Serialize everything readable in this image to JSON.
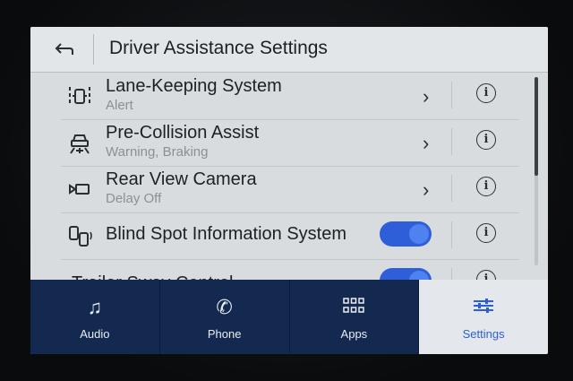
{
  "header": {
    "title": "Driver Assistance Settings",
    "back_icon": "back-arrow-icon"
  },
  "rows": [
    {
      "label": "Lane-Keeping System",
      "sub": "Alert",
      "control": "chevron",
      "icon": "lane-keeping-icon"
    },
    {
      "label": "Pre-Collision Assist",
      "sub": "Warning, Braking",
      "control": "chevron",
      "icon": "pre-collision-icon"
    },
    {
      "label": "Rear View Camera",
      "sub": "Delay Off",
      "control": "chevron",
      "icon": "rear-camera-icon"
    },
    {
      "label": "Blind Spot Information System",
      "sub": "",
      "control": "toggle",
      "toggle_on": true,
      "icon": "blind-spot-icon"
    },
    {
      "label": "Trailer Sway Control",
      "sub": "",
      "control": "toggle",
      "toggle_on": true,
      "icon": ""
    }
  ],
  "nav": {
    "items": [
      {
        "label": "Audio",
        "icon": "music-note-icon"
      },
      {
        "label": "Phone",
        "icon": "phone-icon"
      },
      {
        "label": "Apps",
        "icon": "apps-grid-icon"
      },
      {
        "label": "Settings",
        "icon": "settings-sliders-icon",
        "active": true
      }
    ]
  },
  "colors": {
    "accent": "#2d5fd4",
    "toggle_on": "#2f5fd8",
    "nav_bg": "#14294f",
    "screen_bg": "#d9dcdf"
  }
}
